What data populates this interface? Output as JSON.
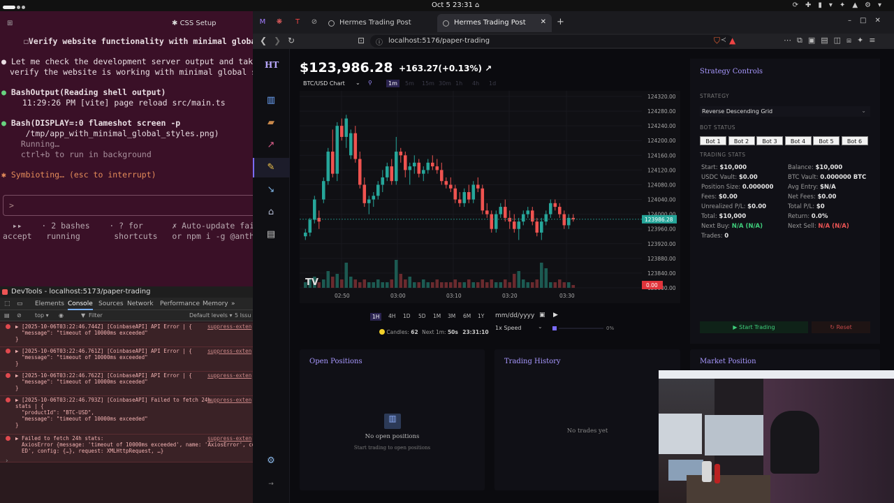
{
  "system": {
    "clock": "Oct 5 23:31"
  },
  "terminal": {
    "title": "CSS Setup",
    "lines": [
      "☐Verify website functionality with minimal globa",
      "Let me check the development server output and take",
      "verify the website is working with minimal global st",
      "BashOutput(Reading shell output)",
      "  11:29:26 PM [vite] page reload src/main.ts",
      "Bash(DISPLAY=:0 flameshot screen -p",
      "     /tmp/app_with_minimal_global_styles.png)",
      "  Running…",
      "  ctrl+b to run in background",
      "Symbioting… (esc to interrupt)"
    ],
    "prompt": ">",
    "footer1": "  ▸▸    · 2 bashes    · ? for      ✗ Auto-update fai",
    "footer2": "accept   running       shortcuts   or npm i -g @anth"
  },
  "devtools": {
    "title": "DevTools - localhost:5173/paper-trading",
    "tabs": [
      "Elements",
      "Console",
      "Sources",
      "Network",
      "Performance",
      "Memory",
      "»"
    ],
    "context": "top ▾",
    "filter_placeholder": "Filter",
    "levels": "Default levels ▾",
    "issues": "5 Issu",
    "entries": [
      {
        "lines": [
          "▶ [2025-10-06T03:22:46.744Z] [CoinbaseAPI] API Error | {",
          "  \"message\": \"timeout of 10000ms exceeded\"",
          "}"
        ],
        "src": "suppress-exten"
      },
      {
        "lines": [
          "▶ [2025-10-06T03:22:46.761Z] [CoinbaseAPI] API Error | {",
          "  \"message\": \"timeout of 10000ms exceeded\"",
          "}"
        ],
        "src": "suppress-exten"
      },
      {
        "lines": [
          "▶ [2025-10-06T03:22:46.762Z] [CoinbaseAPI] API Error | {",
          "  \"message\": \"timeout of 10000ms exceeded\"",
          "}"
        ],
        "src": "suppress-exten"
      },
      {
        "lines": [
          "▶ [2025-10-06T03:22:46.793Z] [CoinbaseAPI] Failed to fetch 24h",
          "stats | {",
          "  \"productId\": \"BTC-USD\",",
          "  \"message\": \"timeout of 10000ms exceeded\"",
          "}"
        ],
        "src": "suppress-exten"
      },
      {
        "lines": [
          "▶ Failed to fetch 24h stats:",
          "  AxiosError {message: 'timeout of 10000ms exceeded', name: 'AxiosError', co",
          "  ED', config: {…}, request: XMLHttpRequest, …}"
        ],
        "src": "suppress-exten"
      }
    ]
  },
  "browser": {
    "tabs": [
      {
        "title": "Hermes Trading Post",
        "active": false
      },
      {
        "title": "Hermes Trading Post",
        "active": true
      }
    ],
    "new_tab": "+",
    "url": "localhost:5176/paper-trading"
  },
  "app": {
    "logo": "HT",
    "nav_icons": [
      "chart-icon",
      "briefcase-icon",
      "trend-icon",
      "notepad-icon",
      "graph-icon",
      "bank-icon",
      "news-icon"
    ],
    "price": "$123,986.28",
    "change": "+163.27(+0.13%)",
    "change_icon": "↗",
    "chart_selector": "BTC/USD Chart",
    "granularities": [
      "1m",
      "5m",
      "15m",
      "30m",
      "1h",
      "4h",
      "1d"
    ],
    "ranges": [
      "1H",
      "4H",
      "1D",
      "5D",
      "1M",
      "3M",
      "6M",
      "1Y"
    ],
    "date_placeholder": "mm/dd/yyyy",
    "speed": "1x Speed",
    "progress": "0%",
    "candles_label": "Candles:",
    "candles": "62",
    "next_label": "Next 1m:",
    "next": "50s",
    "time": "23:31:10",
    "y_ticks": [
      "124320.00",
      "124280.00",
      "124240.00",
      "124200.00",
      "124160.00",
      "124120.00",
      "124080.00",
      "124040.00",
      "124000.00",
      "123960.00",
      "123920.00",
      "123880.00",
      "123840.00",
      "123800.00"
    ],
    "x_ticks": [
      "02:50",
      "03:00",
      "03:10",
      "03:20",
      "03:30"
    ],
    "price_tag": "123986.28",
    "volume_tag": "0.00"
  },
  "strategy": {
    "title": "Strategy Controls",
    "strategy_label": "STRATEGY",
    "strategy_value": "Reverse Descending Grid",
    "bot_status_label": "BOT STATUS",
    "bots": [
      "Bot 1",
      "Bot 2",
      "Bot 3",
      "Bot 4",
      "Bot 5",
      "Bot 6"
    ],
    "stats_label": "TRADING STATS",
    "stats_left": [
      [
        "Start:",
        "$10,000"
      ],
      [
        "USDC Vault:",
        "$0.00"
      ],
      [
        "Position Size:",
        "0.000000"
      ],
      [
        "Fees:",
        "$0.00"
      ],
      [
        "Unrealized P/L:",
        "$0.00"
      ],
      [
        "Total:",
        "$10,000"
      ],
      [
        "Next Buy:",
        "N/A (N/A)"
      ],
      [
        "Trades:",
        "0"
      ]
    ],
    "stats_right": [
      [
        "Balance:",
        "$10,000"
      ],
      [
        "BTC Vault:",
        "0.000000 BTC"
      ],
      [
        "Avg Entry:",
        "$N/A"
      ],
      [
        "Net Fees:",
        "$0.00"
      ],
      [
        "Total P/L:",
        "$0"
      ],
      [
        "Return:",
        "0.0%"
      ],
      [
        "Next Sell:",
        "N/A (N/A)"
      ]
    ],
    "start_button": "▶ Start Trading",
    "reset_button": "↻ Reset"
  },
  "panels": {
    "open_positions": {
      "title": "Open Positions",
      "empty": "No open positions",
      "hint": "Start trading to open positions"
    },
    "history": {
      "title": "Trading History",
      "empty": "No trades yet"
    },
    "market": {
      "title": "Market Position"
    }
  },
  "colors": {
    "up": "#26a69a",
    "down": "#ef5350",
    "accent": "#9c8cff",
    "terminal_bg": "#3a1027"
  },
  "chart_data": {
    "type": "candlestick",
    "x_ticks": [
      "02:50",
      "03:00",
      "03:10",
      "03:20",
      "03:30"
    ],
    "ylim": [
      123800,
      124320
    ],
    "last_price": 123986.28,
    "ohlc": [
      [
        123940,
        123960,
        123930,
        123950
      ],
      [
        123950,
        123990,
        123940,
        123985
      ],
      [
        123985,
        124050,
        123975,
        124040
      ],
      [
        123990,
        124010,
        123960,
        123980
      ],
      [
        124040,
        124100,
        124030,
        124090
      ],
      [
        124090,
        124180,
        124080,
        124170
      ],
      [
        124170,
        124230,
        124100,
        124110
      ],
      [
        124110,
        124250,
        124090,
        124240
      ],
      [
        124240,
        124260,
        124200,
        124210
      ],
      [
        124210,
        124270,
        124180,
        124260
      ],
      [
        124160,
        124230,
        124150,
        124220
      ],
      [
        124220,
        124240,
        124140,
        124150
      ],
      [
        124150,
        124170,
        124070,
        124080
      ],
      [
        124080,
        124100,
        124020,
        124030
      ],
      [
        124030,
        124050,
        124000,
        124040
      ],
      [
        124040,
        124060,
        124020,
        124050
      ],
      [
        124050,
        124090,
        124040,
        124080
      ],
      [
        124080,
        124120,
        124060,
        124100
      ],
      [
        124100,
        124140,
        124090,
        124130
      ],
      [
        124130,
        124150,
        124080,
        124090
      ],
      [
        124090,
        124210,
        124080,
        124170
      ],
      [
        124170,
        124180,
        124140,
        124160
      ],
      [
        124160,
        124170,
        124100,
        124120
      ],
      [
        124120,
        124140,
        124080,
        124130
      ],
      [
        124130,
        124160,
        124110,
        124140
      ],
      [
        124140,
        124150,
        124100,
        124110
      ],
      [
        124110,
        124130,
        124090,
        124120
      ],
      [
        124120,
        124150,
        124110,
        124140
      ],
      [
        124140,
        124160,
        124120,
        124130
      ],
      [
        124130,
        124150,
        124110,
        124120
      ],
      [
        124120,
        124140,
        124080,
        124090
      ],
      [
        124090,
        124100,
        124070,
        124080
      ],
      [
        124080,
        124100,
        124060,
        124070
      ],
      [
        124070,
        124080,
        124030,
        124040
      ],
      [
        124040,
        124060,
        124020,
        124030
      ],
      [
        124030,
        124070,
        124020,
        124060
      ],
      [
        124060,
        124080,
        124030,
        124040
      ],
      [
        124040,
        124090,
        124030,
        124080
      ],
      [
        124080,
        124100,
        124060,
        124070
      ],
      [
        124070,
        124080,
        124000,
        124010
      ],
      [
        124010,
        124030,
        123990,
        124000
      ],
      [
        124000,
        124010,
        123950,
        123960
      ],
      [
        123960,
        124010,
        123950,
        124000
      ],
      [
        124000,
        124030,
        123990,
        124020
      ],
      [
        124020,
        124040,
        123980,
        123990
      ],
      [
        123990,
        124010,
        123960,
        123980
      ],
      [
        123980,
        124000,
        123950,
        123960
      ],
      [
        123960,
        123990,
        123930,
        123980
      ],
      [
        123980,
        124010,
        123970,
        124000
      ],
      [
        124000,
        124020,
        123990,
        124010
      ],
      [
        124010,
        124020,
        123970,
        123980
      ],
      [
        123980,
        123990,
        123940,
        123950
      ],
      [
        123950,
        123990,
        123930,
        123980
      ],
      [
        123980,
        124010,
        123970,
        124000
      ],
      [
        124000,
        124040,
        123990,
        124030
      ],
      [
        124030,
        124040,
        124010,
        124020
      ],
      [
        124020,
        124030,
        123990,
        124000
      ],
      [
        124000,
        124010,
        123960,
        123970
      ],
      [
        123970,
        124000,
        123960,
        123990
      ],
      [
        123990,
        124000,
        123980,
        123986
      ]
    ],
    "volume": [
      2,
      3,
      4,
      2,
      3,
      6,
      4,
      5,
      3,
      9,
      4,
      3,
      2,
      3,
      2,
      2,
      3,
      2,
      2,
      3,
      10,
      5,
      3,
      4,
      2,
      2,
      3,
      2,
      2,
      3,
      2,
      2,
      2,
      3,
      2,
      2,
      3,
      2,
      2,
      3,
      2,
      3,
      2,
      2,
      3,
      2,
      5,
      6,
      3,
      2,
      2,
      3,
      9,
      7,
      2,
      2,
      3,
      2,
      2,
      1
    ]
  }
}
